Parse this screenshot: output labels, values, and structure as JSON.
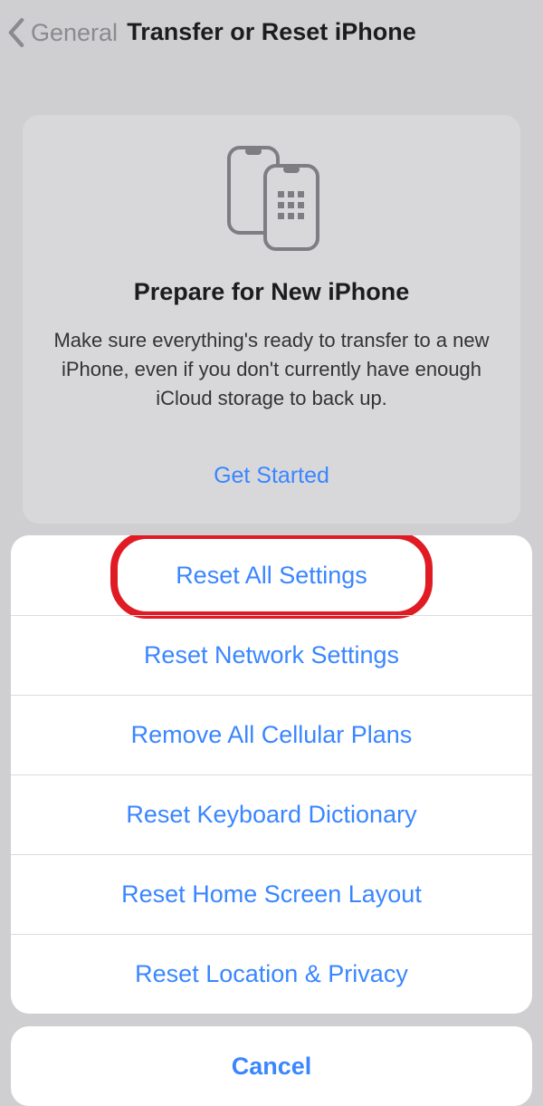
{
  "nav": {
    "back_label": "General",
    "title": "Transfer or Reset iPhone"
  },
  "card": {
    "heading": "Prepare for New iPhone",
    "body": "Make sure everything's ready to transfer to a new iPhone, even if you don't currently have enough iCloud storage to back up.",
    "cta": "Get Started"
  },
  "sheet": {
    "options": [
      "Reset All Settings",
      "Reset Network Settings",
      "Remove All Cellular Plans",
      "Reset Keyboard Dictionary",
      "Reset Home Screen Layout",
      "Reset Location & Privacy"
    ],
    "cancel": "Cancel",
    "highlighted_index": 0
  },
  "colors": {
    "link": "#3a86ff",
    "highlight": "#e01b24"
  }
}
